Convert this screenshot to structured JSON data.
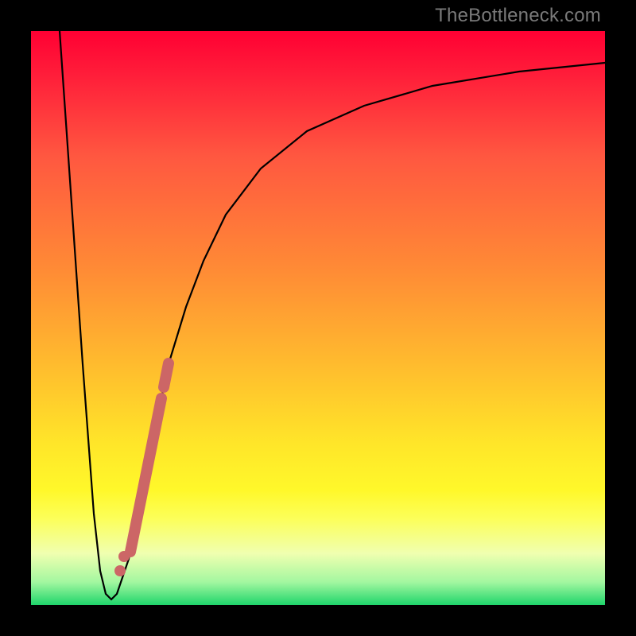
{
  "watermark": "TheBottleneck.com",
  "chart_data": {
    "type": "line",
    "title": "",
    "xlabel": "",
    "ylabel": "",
    "xlim": [
      0,
      100
    ],
    "ylim": [
      0,
      100
    ],
    "series": [
      {
        "name": "bottleneck-curve",
        "color": "#000000",
        "x": [
          5,
          7,
          9,
          11,
          12,
          13,
          14,
          15,
          17,
          19,
          21,
          24,
          27,
          30,
          34,
          40,
          48,
          58,
          70,
          85,
          100
        ],
        "y": [
          100,
          72,
          42,
          16,
          6,
          2,
          1,
          2,
          8,
          18,
          28,
          42,
          52,
          60,
          68,
          76,
          82.5,
          87,
          90.5,
          93,
          94.5
        ]
      }
    ],
    "highlight_segment": {
      "name": "highlighted-region",
      "color": "#cc6666",
      "x": [
        15.5,
        22.7
      ],
      "y": [
        3.5,
        36
      ]
    },
    "highlight_dots": [
      {
        "x": 15.5,
        "y": 6.0
      },
      {
        "x": 16.2,
        "y": 8.5
      }
    ],
    "background_gradient": {
      "top": "#ff0033",
      "middle": "#ffe629",
      "bottom": "#1fd56b"
    }
  }
}
